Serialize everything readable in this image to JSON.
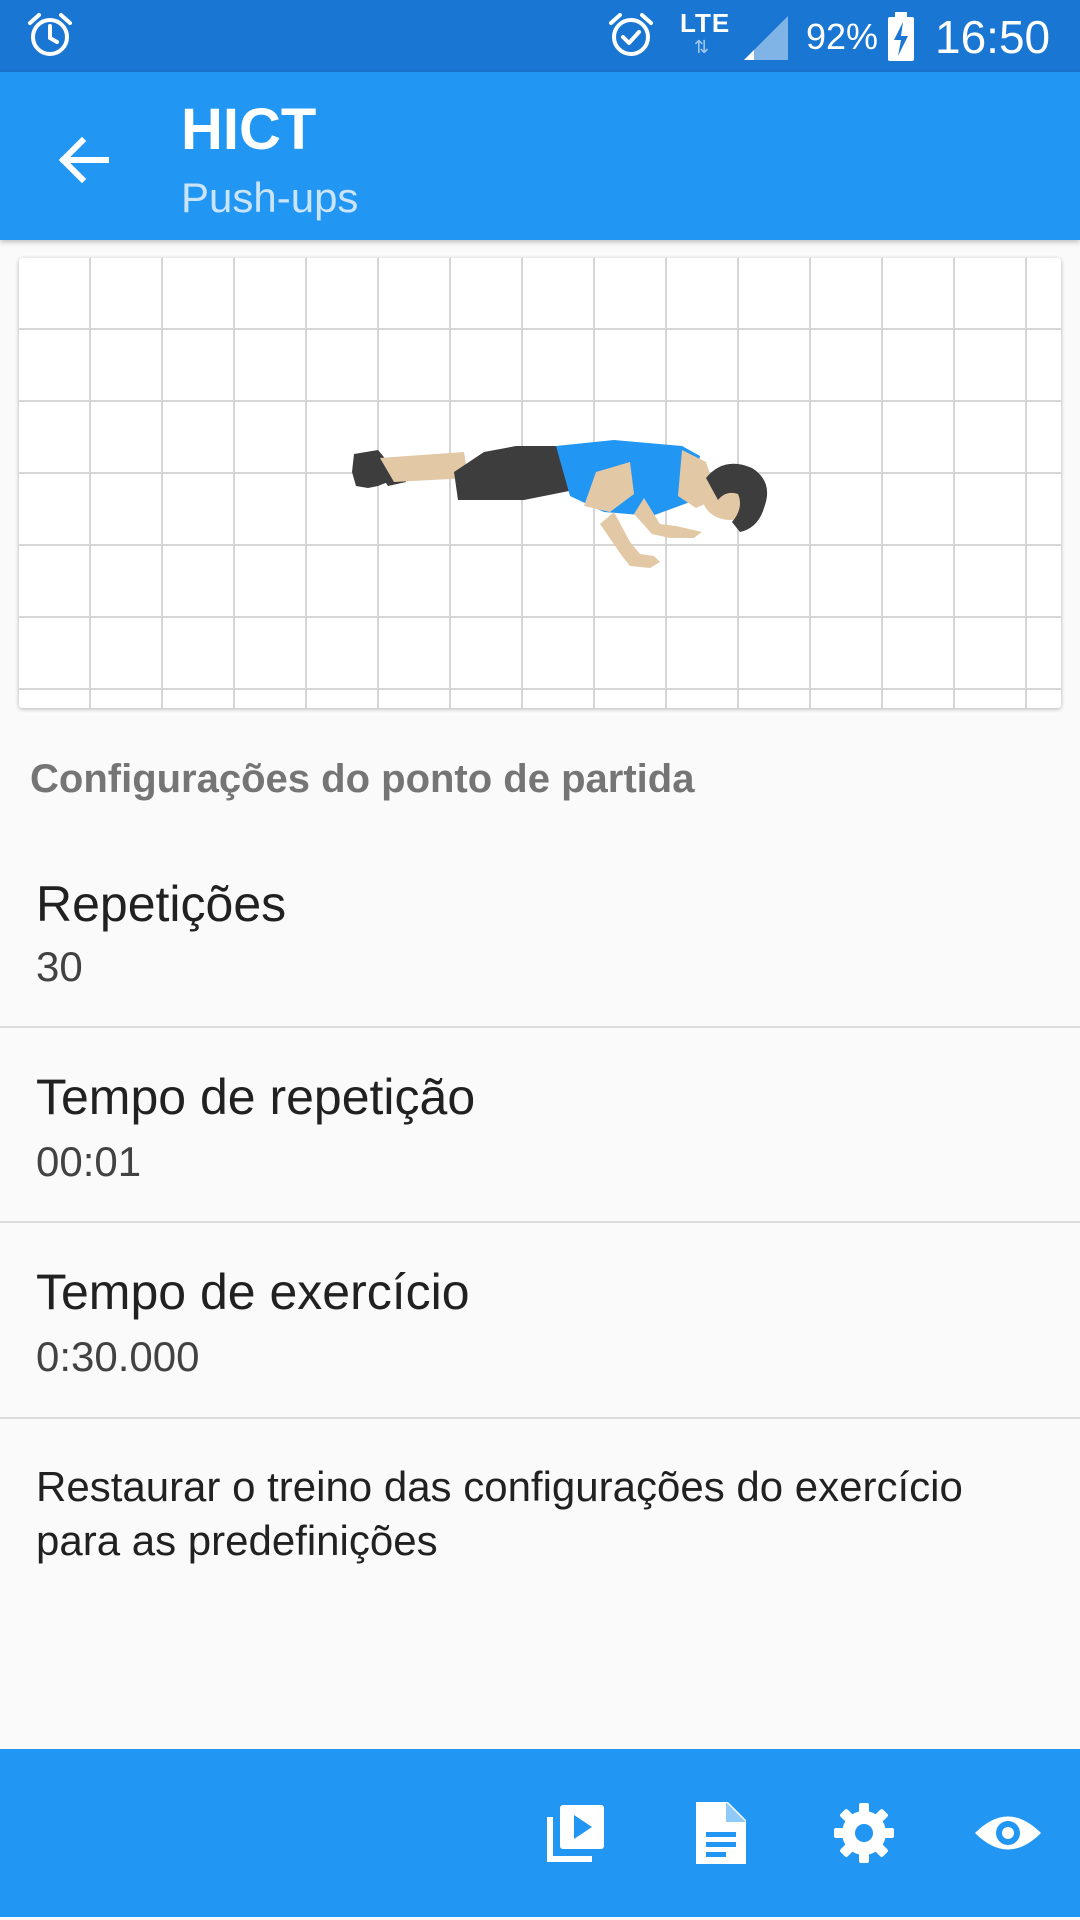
{
  "status_bar": {
    "network": "LTE",
    "battery_percent": "92%",
    "time": "16:50",
    "icons": [
      "alarm-icon",
      "alarm-icon",
      "lte-icon",
      "signal-icon",
      "battery-charging-icon"
    ]
  },
  "app_bar": {
    "title": "HICT",
    "subtitle": "Push-ups",
    "back_icon": "arrow-back-icon"
  },
  "exercise_image": {
    "icon": "push-up-figure"
  },
  "settings": {
    "section_title": "Configurações do ponto de partida",
    "items": [
      {
        "label": "Repetições",
        "value": "30"
      },
      {
        "label": "Tempo de repetição",
        "value": "00:01"
      },
      {
        "label": "Tempo de exercício",
        "value": "0:30.000"
      }
    ],
    "restore_label": "Restaurar o treino das configurações do exercício para as predefinições"
  },
  "bottom_bar": {
    "icons": [
      "video-library-icon",
      "document-icon",
      "gear-icon",
      "eye-icon"
    ]
  },
  "colors": {
    "status_bar": "#1976d2",
    "primary": "#2196f3",
    "background": "#fafafa",
    "section_header": "#757575"
  }
}
